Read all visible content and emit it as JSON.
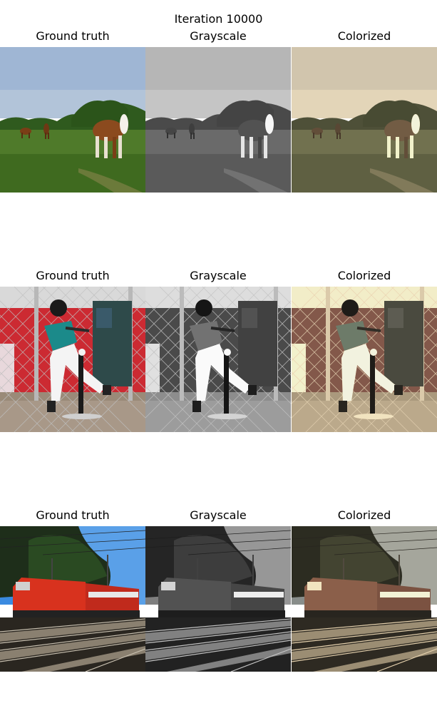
{
  "figure": {
    "title": "Iteration 10000"
  },
  "rows": [
    {
      "panels": [
        {
          "title": "Ground truth"
        },
        {
          "title": "Grayscale"
        },
        {
          "title": "Colorized"
        }
      ]
    },
    {
      "panels": [
        {
          "title": "Ground truth"
        },
        {
          "title": "Grayscale"
        },
        {
          "title": "Colorized"
        }
      ]
    },
    {
      "panels": [
        {
          "title": "Ground truth"
        },
        {
          "title": "Grayscale"
        },
        {
          "title": "Colorized"
        }
      ]
    }
  ]
}
